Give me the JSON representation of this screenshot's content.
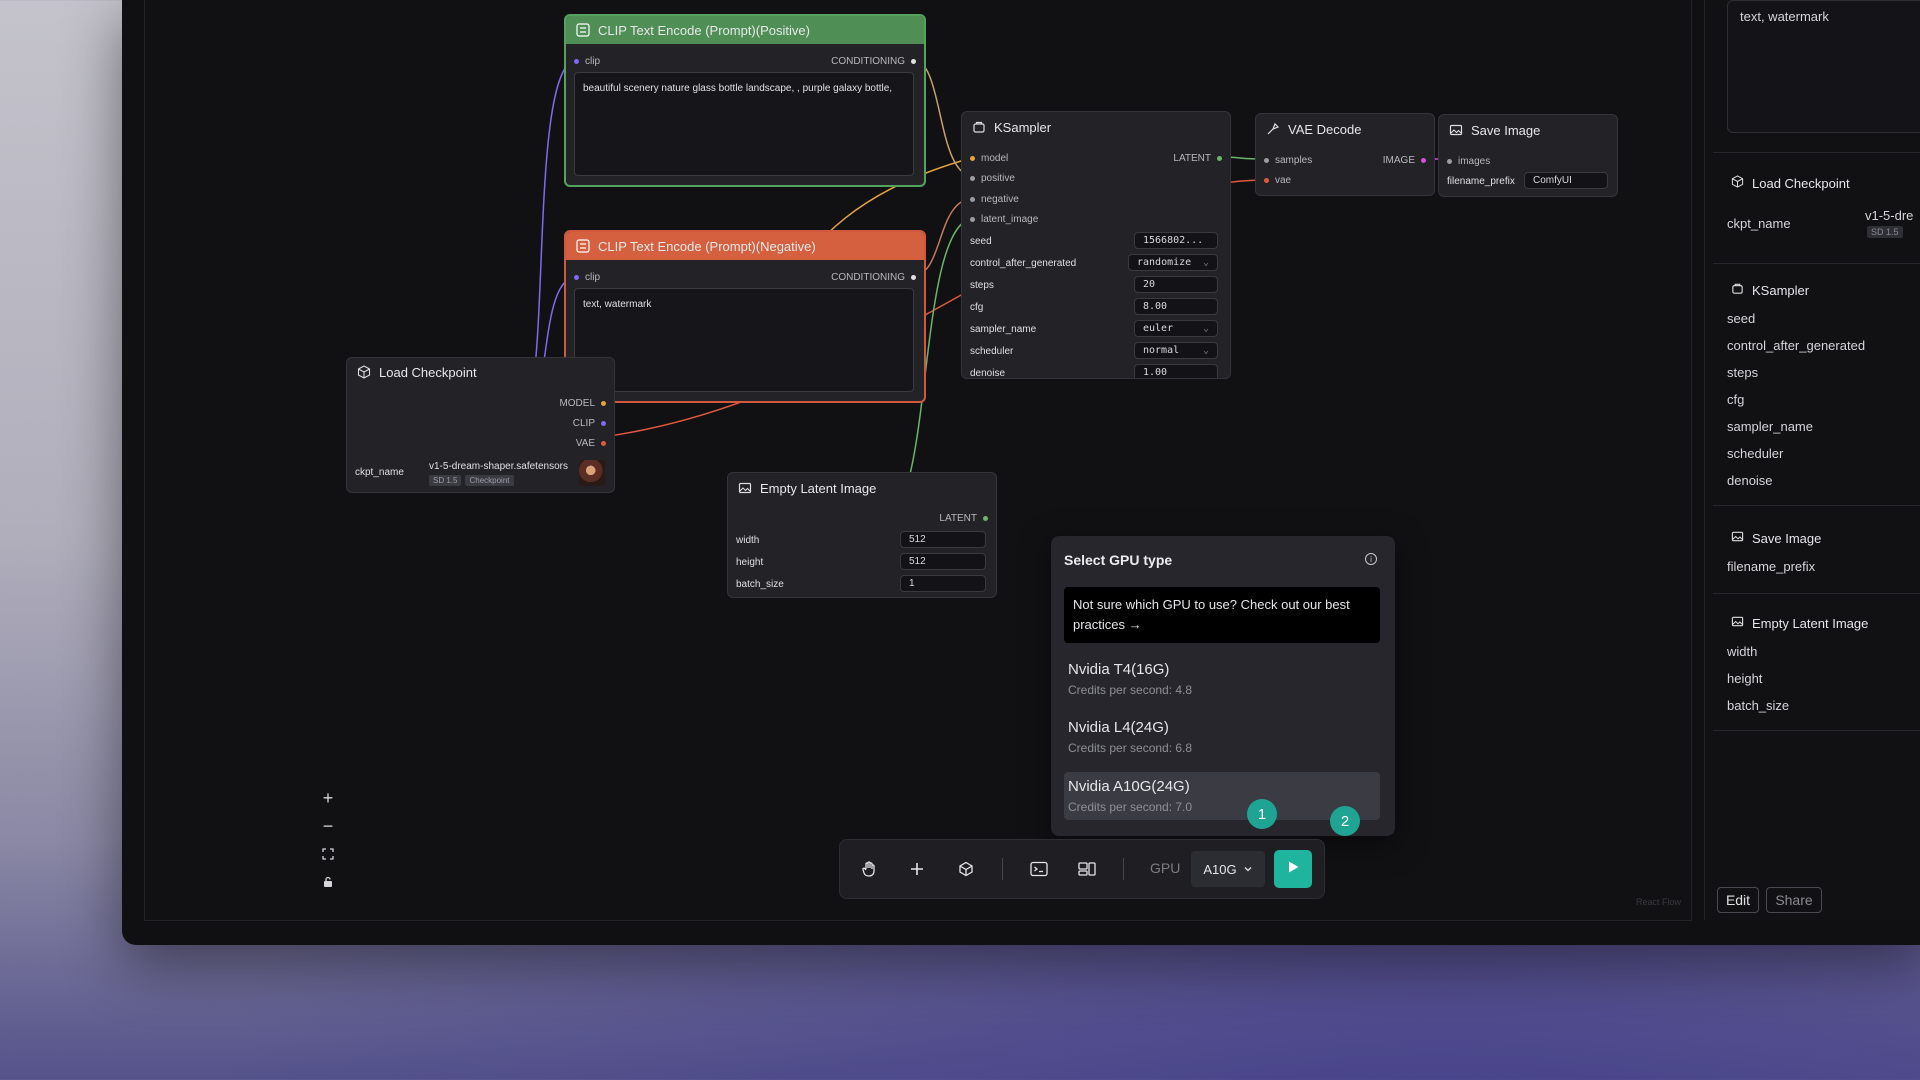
{
  "nodes": {
    "positive": {
      "title": "CLIP Text Encode (Prompt)(Positive)",
      "in_clip": "clip",
      "out": "CONDITIONING",
      "text": "beautiful scenery nature glass bottle landscape, , purple galaxy bottle,"
    },
    "negative": {
      "title": "CLIP Text Encode (Prompt)(Negative)",
      "in_clip": "clip",
      "out": "CONDITIONING",
      "text": "text, watermark"
    },
    "checkpoint": {
      "title": "Load Checkpoint",
      "out_model": "MODEL",
      "out_clip": "CLIP",
      "out_vae": "VAE",
      "ckpt_label": "ckpt_name",
      "ckpt_value": "v1-5-dream-shaper.safetensors",
      "tag1": "SD 1.5",
      "tag2": "Checkpoint"
    },
    "ksampler": {
      "title": "KSampler",
      "in_model": "model",
      "in_positive": "positive",
      "in_negative": "negative",
      "in_latent": "latent_image",
      "out": "LATENT",
      "f_seed": "seed",
      "v_seed": "1566802...",
      "f_control": "control_after_generated",
      "v_control": "randomize",
      "f_steps": "steps",
      "v_steps": "20",
      "f_cfg": "cfg",
      "v_cfg": "8.00",
      "f_sampler": "sampler_name",
      "v_sampler": "euler",
      "f_scheduler": "scheduler",
      "v_scheduler": "normal",
      "f_denoise": "denoise",
      "v_denoise": "1.00"
    },
    "vae": {
      "title": "VAE Decode",
      "in_samples": "samples",
      "in_vae": "vae",
      "out": "IMAGE"
    },
    "save": {
      "title": "Save Image",
      "in_images": "images",
      "f_prefix": "filename_prefix",
      "v_prefix": "ComfyUI"
    },
    "latent": {
      "title": "Empty Latent Image",
      "out": "LATENT",
      "f_width": "width",
      "v_width": "512",
      "f_height": "height",
      "v_height": "512",
      "f_batch": "batch_size",
      "v_batch": "1"
    }
  },
  "gpu_popup": {
    "title": "Select GPU type",
    "tip": "Not sure which GPU to use? Check out our best practices →",
    "options": [
      {
        "name": "Nvidia T4(16G)",
        "credits": "Credits per second: 4.8"
      },
      {
        "name": "Nvidia L4(24G)",
        "credits": "Credits per second: 6.8"
      },
      {
        "name": "Nvidia A10G(24G)",
        "credits": "Credits per second: 7.0"
      }
    ]
  },
  "badges": [
    "1",
    "2"
  ],
  "toolbar": {
    "gpu_label": "GPU",
    "gpu_value": "A10G"
  },
  "canvas_watermark": "React Flow",
  "side_panel": {
    "top_text": "text, watermark",
    "checkpoint": {
      "title": "Load Checkpoint",
      "label": "ckpt_name",
      "value": "v1-5-dre",
      "tag1": "SD 1.5"
    },
    "ksampler": {
      "title": "KSampler",
      "fields": [
        "seed",
        "control_after_generated",
        "steps",
        "cfg",
        "sampler_name",
        "scheduler",
        "denoise"
      ]
    },
    "save": {
      "title": "Save Image",
      "fields": [
        "filename_prefix"
      ]
    },
    "latent": {
      "title": "Empty Latent Image",
      "fields": [
        "width",
        "height",
        "batch_size"
      ]
    },
    "edit_label": "Edit",
    "share_label": "Share"
  },
  "colors": {
    "model": "#e6a23c",
    "clip": "#7b6cf0",
    "vae": "#e2573f",
    "latent": "#6ab56a",
    "image": "#d84fd9",
    "accent": "#1fa393"
  }
}
